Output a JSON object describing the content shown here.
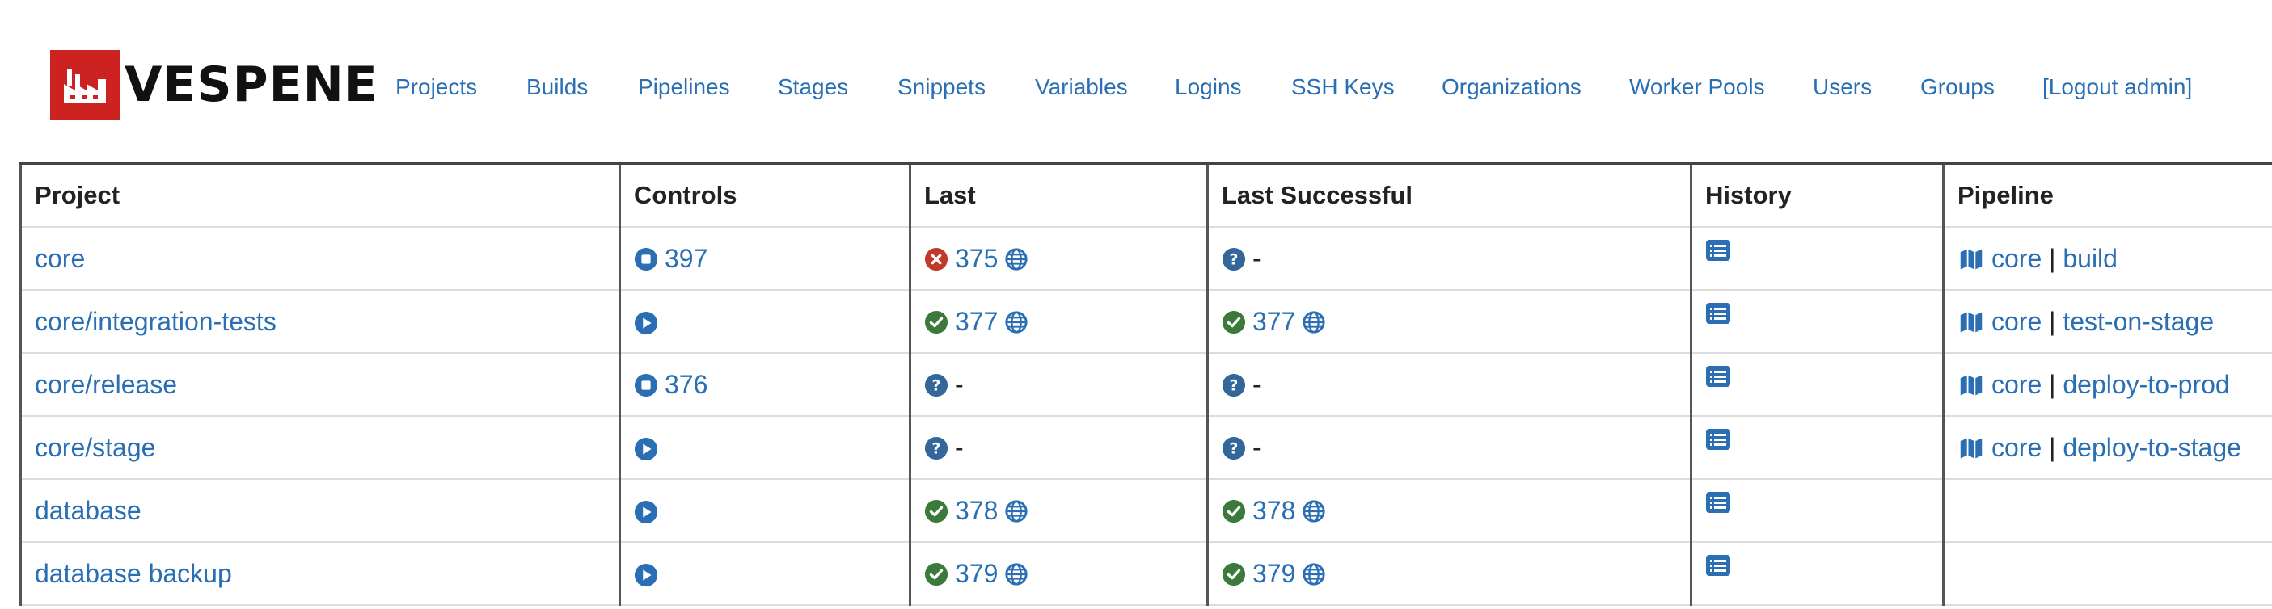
{
  "brand": {
    "name": "VESPENE",
    "color": "#cc2222"
  },
  "nav": [
    "Projects",
    "Builds",
    "Pipelines",
    "Stages",
    "Snippets",
    "Variables",
    "Logins",
    "SSH Keys",
    "Organizations",
    "Worker Pools",
    "Users",
    "Groups",
    "[Logout admin]"
  ],
  "table": {
    "headers": {
      "project": "Project",
      "controls": "Controls",
      "last": "Last",
      "last_successful": "Last Successful",
      "history": "History",
      "pipeline": "Pipeline"
    },
    "rows": [
      {
        "project": "core",
        "control": {
          "icon": "stop-icon",
          "value": "397"
        },
        "last": {
          "status": "failed",
          "value": "375"
        },
        "last_successful": {
          "status": "unknown",
          "value": "-"
        },
        "pipeline": {
          "name": "core",
          "stage": "build"
        }
      },
      {
        "project": "core/integration-tests",
        "control": {
          "icon": "play-icon",
          "value": ""
        },
        "last": {
          "status": "success",
          "value": "377"
        },
        "last_successful": {
          "status": "success",
          "value": "377"
        },
        "pipeline": {
          "name": "core",
          "stage": "test-on-stage"
        }
      },
      {
        "project": "core/release",
        "control": {
          "icon": "stop-icon",
          "value": "376"
        },
        "last": {
          "status": "unknown",
          "value": "-"
        },
        "last_successful": {
          "status": "unknown",
          "value": "-"
        },
        "pipeline": {
          "name": "core",
          "stage": "deploy-to-prod"
        }
      },
      {
        "project": "core/stage",
        "control": {
          "icon": "play-icon",
          "value": ""
        },
        "last": {
          "status": "unknown",
          "value": "-"
        },
        "last_successful": {
          "status": "unknown",
          "value": "-"
        },
        "pipeline": {
          "name": "core",
          "stage": "deploy-to-stage"
        }
      },
      {
        "project": "database",
        "control": {
          "icon": "play-icon",
          "value": ""
        },
        "last": {
          "status": "success",
          "value": "378"
        },
        "last_successful": {
          "status": "success",
          "value": "378"
        },
        "pipeline": null
      },
      {
        "project": "database backup",
        "control": {
          "icon": "play-icon",
          "value": ""
        },
        "last": {
          "status": "success",
          "value": "379"
        },
        "last_successful": {
          "status": "success",
          "value": "379"
        },
        "pipeline": null
      }
    ]
  },
  "colors": {
    "link": "#2a6fb4",
    "success": "#3c7a3c",
    "failed": "#c0392b",
    "unknown": "#336699",
    "control": "#2a6fb4"
  }
}
